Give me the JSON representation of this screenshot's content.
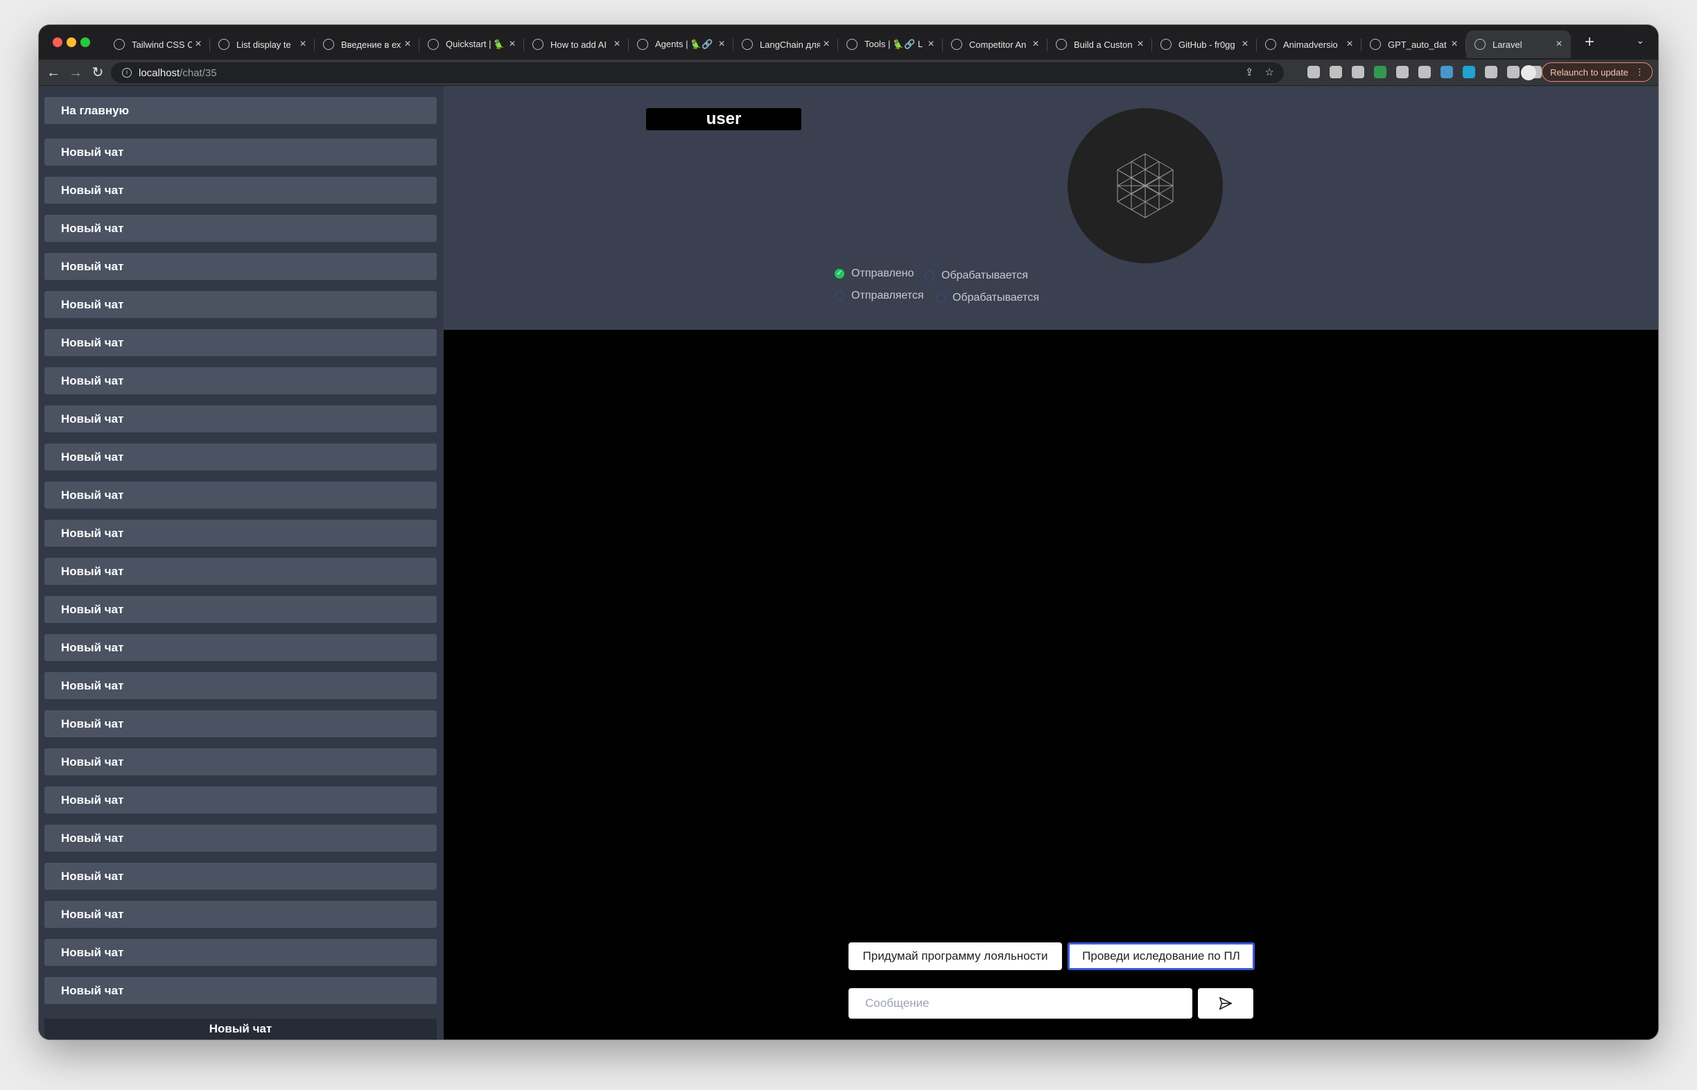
{
  "browser": {
    "tabs": [
      {
        "title": "Tailwind CSS C",
        "icon": "tailwind-icon"
      },
      {
        "title": "List display te",
        "icon": "list-icon"
      },
      {
        "title": "Введение в ех",
        "icon": "intro-icon"
      },
      {
        "title": "Quickstart | 🦜",
        "icon": "quickstart-icon"
      },
      {
        "title": "How to add AI",
        "icon": "ai-icon"
      },
      {
        "title": "Agents | 🦜🔗",
        "icon": "agents-icon"
      },
      {
        "title": "LangChain для",
        "icon": "langchain-icon"
      },
      {
        "title": "Tools | 🦜🔗 L",
        "icon": "tools-icon"
      },
      {
        "title": "Competitor An",
        "icon": "competitor-icon"
      },
      {
        "title": "Build a Custon",
        "icon": "build-icon"
      },
      {
        "title": "GitHub - fr0gg",
        "icon": "github-icon"
      },
      {
        "title": "Animadversio",
        "icon": "github-icon"
      },
      {
        "title": "GPT_auto_dat",
        "icon": "colab-icon"
      },
      {
        "title": "Laravel",
        "icon": "globe-icon"
      }
    ],
    "url_host": "localhost",
    "url_path": "/chat/35",
    "relaunch_label": "Relaunch to update",
    "relaunch_more": "⋮",
    "new_tab": "+",
    "tab_menu": "⌄"
  },
  "sidebar": {
    "home_label": "На главную",
    "chat_label": "Новый чат",
    "chats": [
      "Новый чат",
      "Новый чат",
      "Новый чат",
      "Новый чат",
      "Новый чат",
      "Новый чат",
      "Новый чат",
      "Новый чат",
      "Новый чат",
      "Новый чат",
      "Новый чат",
      "Новый чат",
      "Новый чат",
      "Новый чат",
      "Новый чат",
      "Новый чат",
      "Новый чат",
      "Новый чат",
      "Новый чат",
      "Новый чат",
      "Новый чат",
      "Новый чат",
      "Новый чат"
    ],
    "bottom_label": "Новый чат"
  },
  "header": {
    "user_label": "user",
    "statuses": [
      {
        "label": "Отправлено",
        "state": "done"
      },
      {
        "label": "Обрабатывается",
        "state": "pending"
      },
      {
        "label": "Отправляется",
        "state": "pending"
      },
      {
        "label": "Обрабатывается",
        "state": "pending"
      }
    ]
  },
  "composer": {
    "suggestions": [
      "Придумай программу лояльности",
      "Проведи иследование по ПЛ"
    ],
    "placeholder": "Сообщение",
    "value": ""
  },
  "colors": {
    "sidebar_bg": "#323846",
    "sidebar_button": "#4b5262",
    "header_bg": "#3a404f",
    "done_status": "#22c55e"
  }
}
